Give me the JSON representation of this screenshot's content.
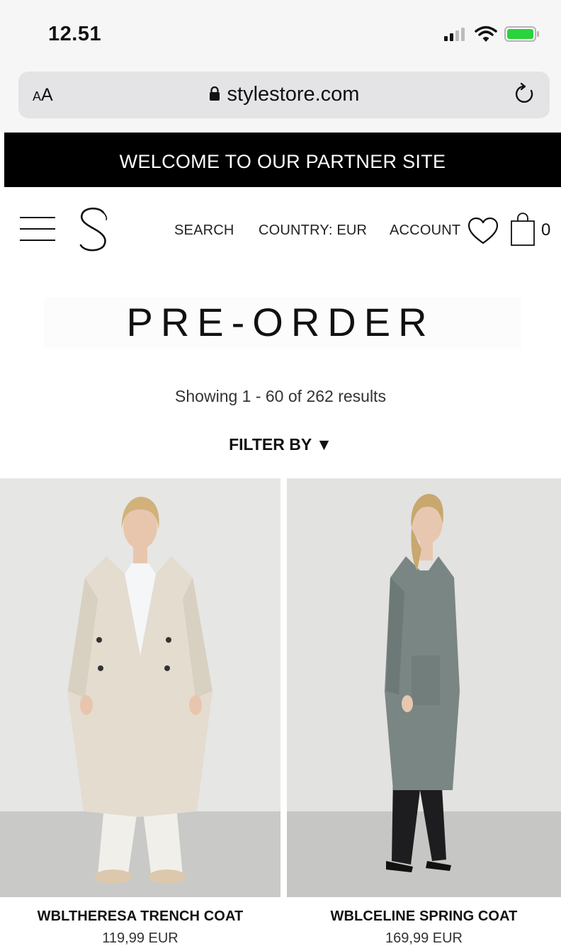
{
  "status_bar": {
    "time": "12.51",
    "battery_color": "#2ad33b"
  },
  "browser": {
    "text_size_label_small": "A",
    "text_size_label_large": "A",
    "url": "stylestore.com"
  },
  "banner": {
    "text": "WELCOME TO OUR PARTNER SITE"
  },
  "nav": {
    "logo_letter": "S",
    "search_label": "SEARCH",
    "country_label": "COUNTRY: EUR",
    "account_label": "ACCOUNT",
    "bag_count": "0"
  },
  "page": {
    "title": "PRE-ORDER",
    "results_text": "Showing 1 - 60 of 262 results",
    "filter_label": "FILTER BY ▼"
  },
  "products": [
    {
      "name": "WBLTHERESA TRENCH COAT",
      "price": "119,99 EUR",
      "coat_color": "#e3dccf"
    },
    {
      "name": "WBLCELINE SPRING COAT",
      "price": "169,99 EUR",
      "coat_color": "#7a8683"
    }
  ]
}
